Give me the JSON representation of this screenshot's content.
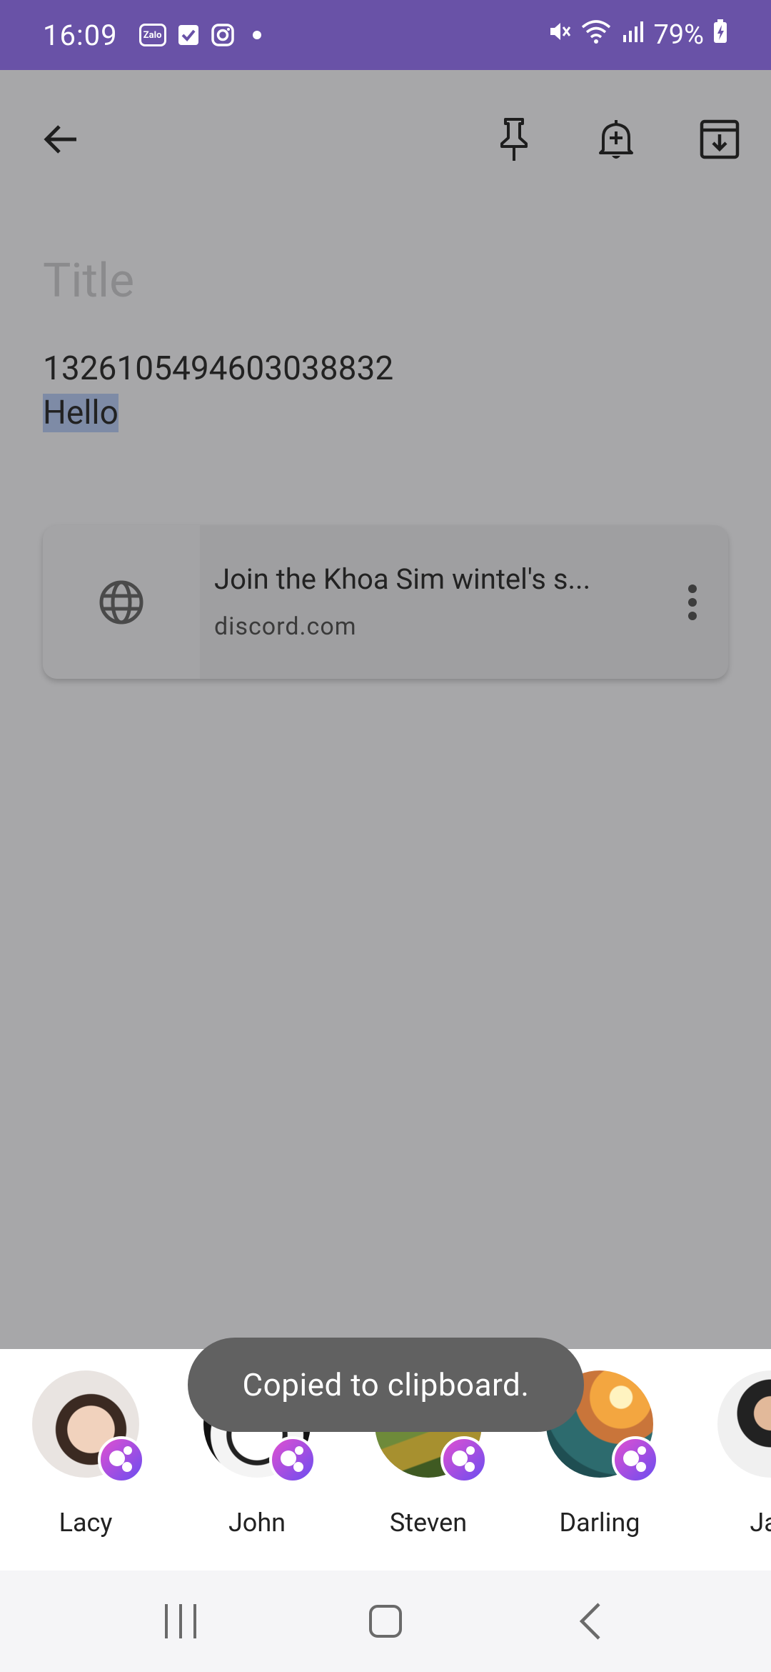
{
  "status_bar": {
    "time": "16:09",
    "notification_icons": [
      "zalo-icon",
      "tasks-check-icon",
      "instagram-icon",
      "dot-icon"
    ],
    "zalo_label": "Zalo",
    "battery": "79%"
  },
  "toolbar": {
    "back": "arrow-left-icon",
    "pin": "pin-icon",
    "reminder": "bell-plus-icon",
    "archive": "archive-icon"
  },
  "note": {
    "title_placeholder": "Title",
    "body_line1": "13261054946030388​32",
    "body_line2_selected": "Hello"
  },
  "link_preview": {
    "title": "Join the Khoa Sim wintel's s...",
    "domain": "discord.com"
  },
  "share_contacts": [
    {
      "name": "Lacy"
    },
    {
      "name": "John"
    },
    {
      "name": "Steven"
    },
    {
      "name": "Darling"
    },
    {
      "name": "Jan"
    }
  ],
  "toast": {
    "message": "Copied to clipboard."
  },
  "colors": {
    "status_bar": "#6952a7",
    "dim_background": "#a7a7a9",
    "selection": "#7e8ba6",
    "toast": "#616161"
  }
}
